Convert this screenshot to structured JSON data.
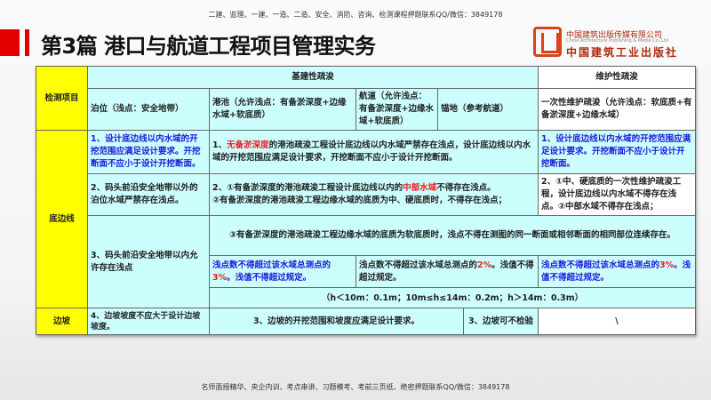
{
  "header": {
    "top_note": "二建、监理、一建、一造、二造、安全、消防、咨询、检测课程押题联系QQ/微信：3849178",
    "title": "第3篇  港口与航道工程项目管理实务",
    "publisher_cn": "中国建筑出版传媒有限公司",
    "publisher_en": "China Architecture Publishing & Media Co.,Ltd",
    "publisher_brand": "中国建筑工业出版社"
  },
  "table": {
    "h_item": "检测项目",
    "h_basic": "基建性疏浚",
    "h_maint": "维护性疏浚",
    "h_berth": "泊位（浅点：安全地带）",
    "h_basin": "港池（允许浅点：有备淤深度+边缘水域+软底质）",
    "h_channel": "航道（允许浅点：有备淤深度+边缘水域+软底质）",
    "h_anchor": "锚地（参考航道）",
    "h_once": "一次性维护疏浚（允许浅点：软底质+有备淤深度+边缘水域）",
    "row_bottom": "底边线",
    "row_slope": "边坡",
    "r1_berth": "1、设计底边线以内水域的开挖范围应满足设计要求。开挖断面不应小于设计开挖断面。",
    "r1_mid_a": "1、",
    "r1_mid_red": "无备淤深度",
    "r1_mid_b": "的港池疏浚工程设计底边线以内水域严禁存在浅点，设计底边线以内水域的开挖范围应满足设计要求，开挖断面不应小于设计开挖断面。",
    "r1_maint": "1、设计底边线以内水域的开挖范围应满足设计要求。开挖断面不应小于设计开挖断面。",
    "r2_berth": "2、码头前沿安全地带以外的泊位水域严禁存在浅点。",
    "r2_mid_a": "2、①有备淤深度的港池疏浚工程设计底边线以内的",
    "r2_mid_red": "中部水域",
    "r2_mid_b": "不得存在浅点。",
    "r2_mid_c": "②有备淤深度的港池疏浚工程边缘水域的底质为中、硬底质时，不得存在浅点；",
    "r2_maint": "2、①中、硬底质的一次性维护疏浚工程，设计底边线以内水域不得存在浅点。②中部水域不得存在浅点；",
    "r3_berth": "3、码头前沿安全地带以内允许存在浅点",
    "r3_span": "③有备淤深度的港池疏浚工程边缘水域的底质为软底质时，浅点不得在测图的同一断面或相邻断面的相同部位连续存在。",
    "r3_basin_a": "浅点数不得超过该水域总测点的",
    "r3_basin_pct": "3%",
    "r3_basin_b": "。浅值不得超过规定。",
    "r3_channel_a": "浅点数不得超过该水域总测点的",
    "r3_channel_pct": "2%",
    "r3_channel_b": "。浅值不得超过规定。",
    "r3_maint_a": "浅点数不得超过该水域总测点的",
    "r3_maint_pct": "3%",
    "r3_maint_b": "。浅值不得超过规定。",
    "r3_limits": "（h＜10m：0.1m；10m≤h≤14m：0.2m；h＞14m：0.3m）",
    "r4_berth": "4、边坡坡度不应大于设计边坡坡度。",
    "r4_mid": "3、边坡的开挖范围和坡度应满足设计要求。",
    "r4_anchor": "3、边坡可不检验",
    "r4_maint": "\\"
  },
  "footer": {
    "note": "名师面授精华、央企内训、考点串讲、习题模考、考前三页纸、绝密押题联系QQ/微信：3849178"
  }
}
